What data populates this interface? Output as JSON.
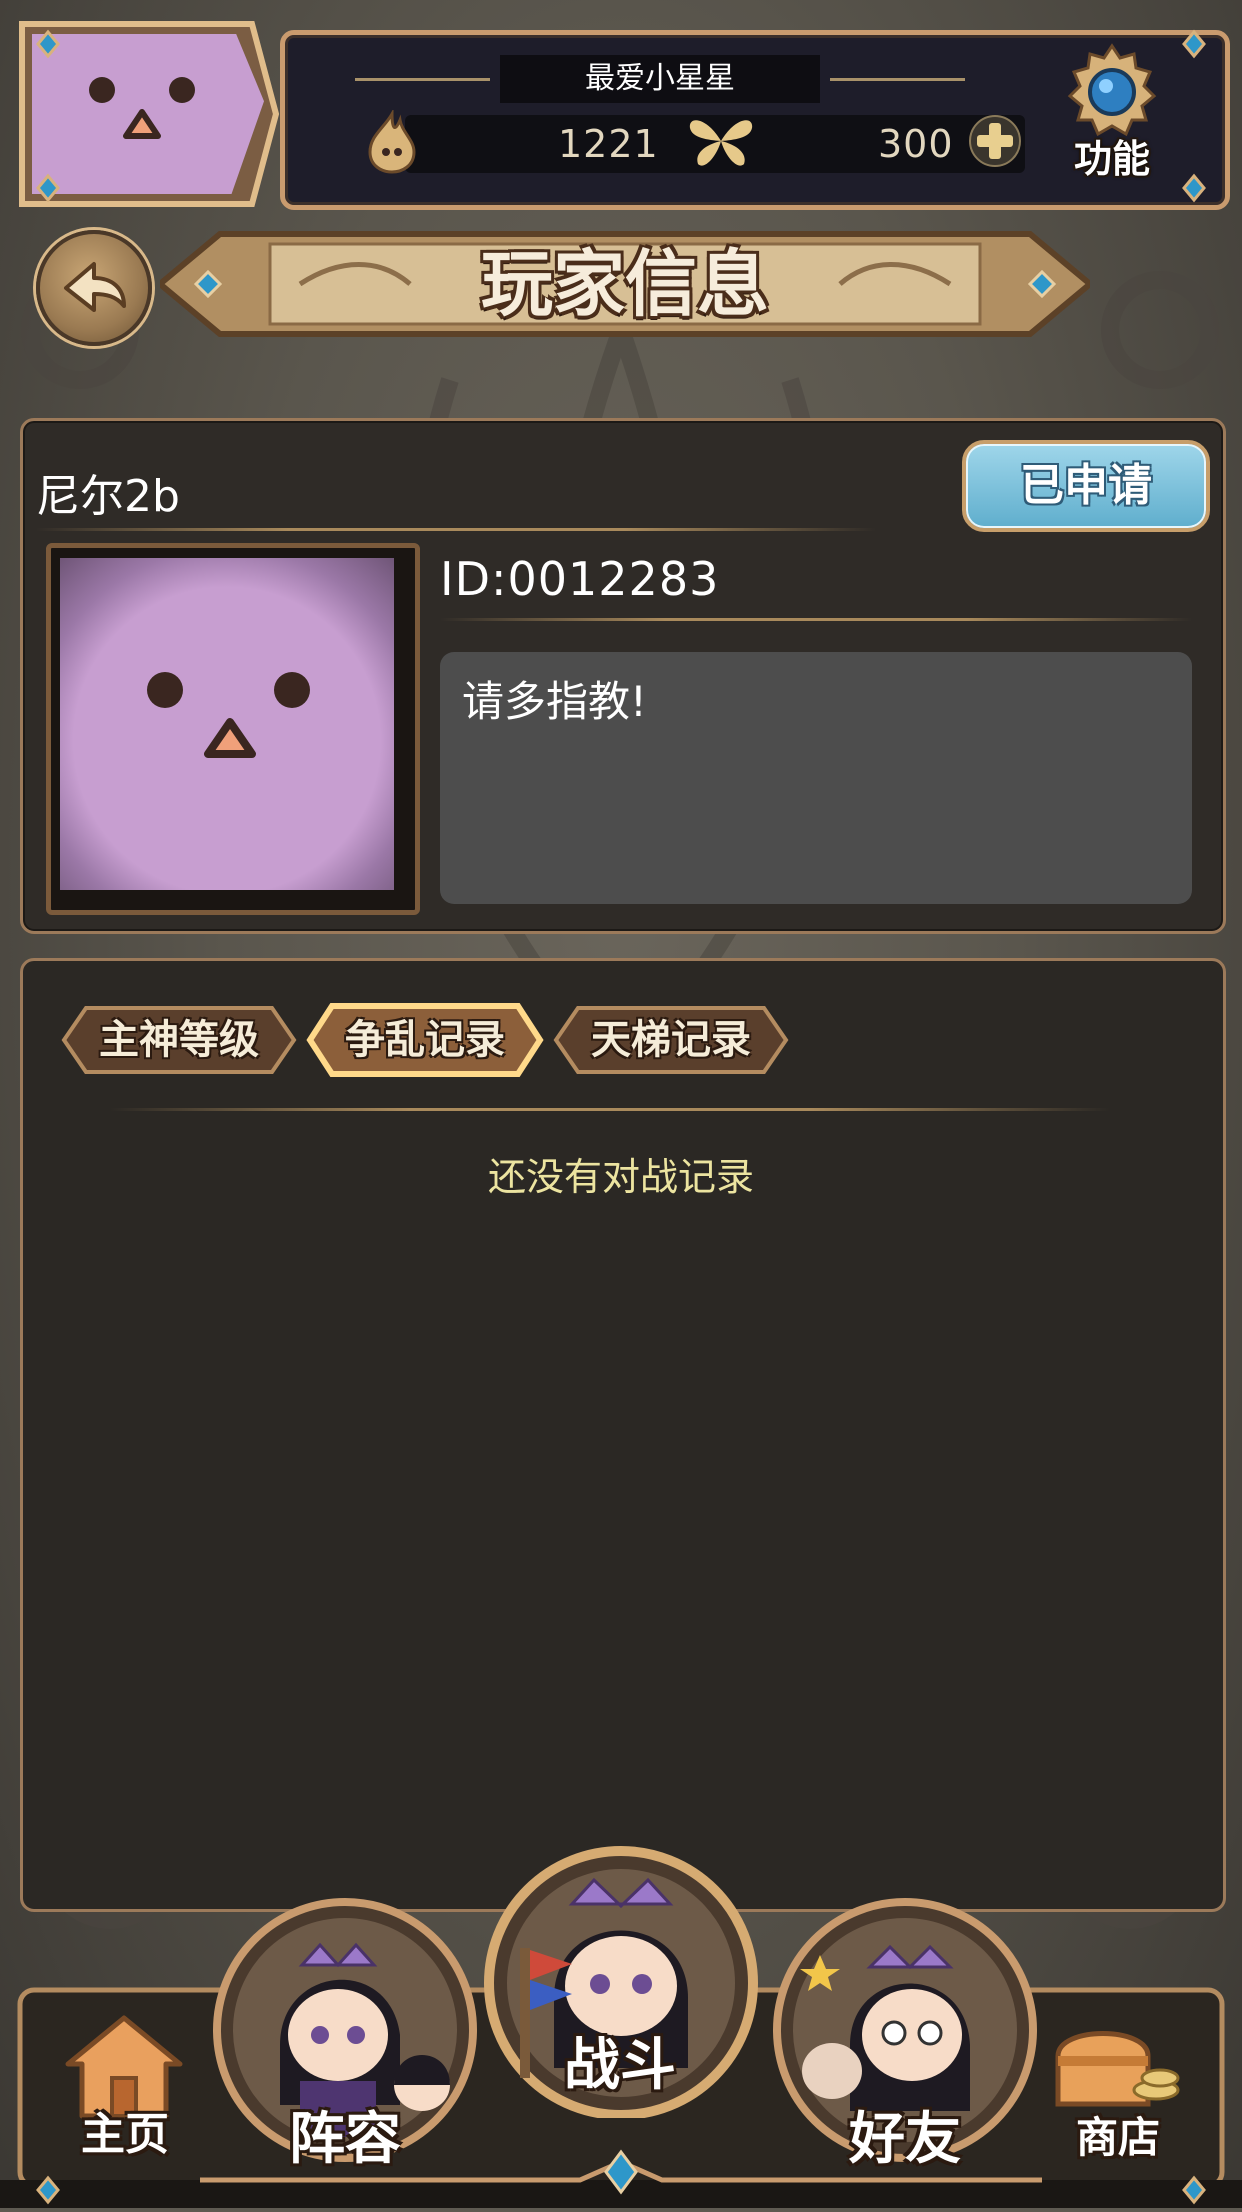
{
  "header": {
    "player_nickname": "最爱小星星",
    "stamina": "1221",
    "gems": "300",
    "function_label": "功能"
  },
  "page_title": "玩家信息",
  "profile": {
    "name": "尼尔2b",
    "status_button": "已申请",
    "id": "ID:0012283",
    "motto": "请多指教!"
  },
  "tabs": [
    {
      "label": "主神等级",
      "active": false
    },
    {
      "label": "争乱记录",
      "active": true
    },
    {
      "label": "天梯记录",
      "active": false
    }
  ],
  "empty_message": "还没有对战记录",
  "bottom_nav": {
    "home": "主页",
    "lineup": "阵容",
    "battle": "战斗",
    "friends": "好友",
    "shop": "商店"
  },
  "colors": {
    "avatar_purple": "#c79ed0",
    "applied_button": "#5faecd",
    "empty_text": "#ece4a0",
    "panel_dark": "#1e1d2a"
  }
}
